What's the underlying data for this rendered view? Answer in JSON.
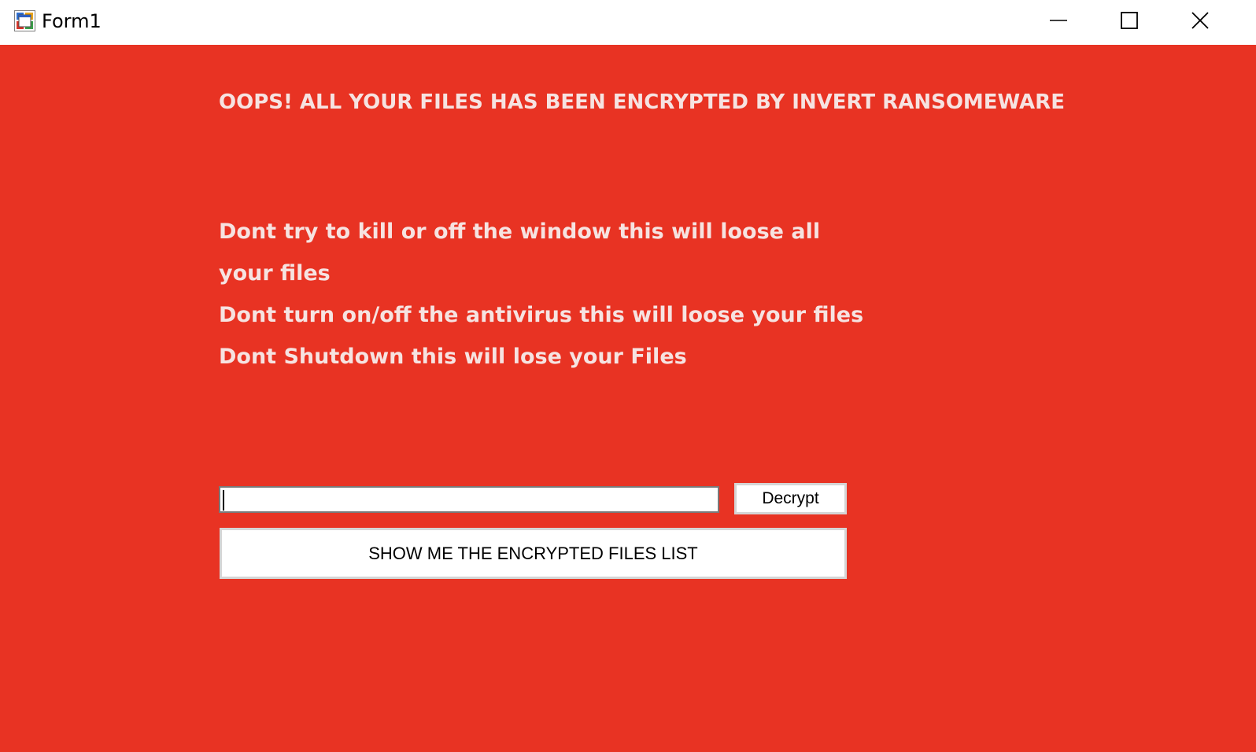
{
  "window": {
    "title": "Form1",
    "icon": "winforms-app-icon",
    "controls": {
      "minimize": "minimize-icon",
      "maximize": "maximize-icon",
      "close": "close-icon"
    }
  },
  "colors": {
    "background": "#e83323",
    "text": "#f6e3e1"
  },
  "content": {
    "heading": "OOPS! ALL YOUR FILES HAS BEEN ENCRYPTED BY INVERT RANSOMEWARE",
    "messages": [
      "Dont try to kill or off the window this will loose all",
      "your files",
      "Dont turn on/off the antivirus this will loose your files",
      "Dont Shutdown this will lose your Files"
    ],
    "key_input": {
      "value": "",
      "placeholder": ""
    },
    "decrypt_button": "Decrypt",
    "show_list_button": "SHOW ME THE ENCRYPTED FILES LIST"
  }
}
